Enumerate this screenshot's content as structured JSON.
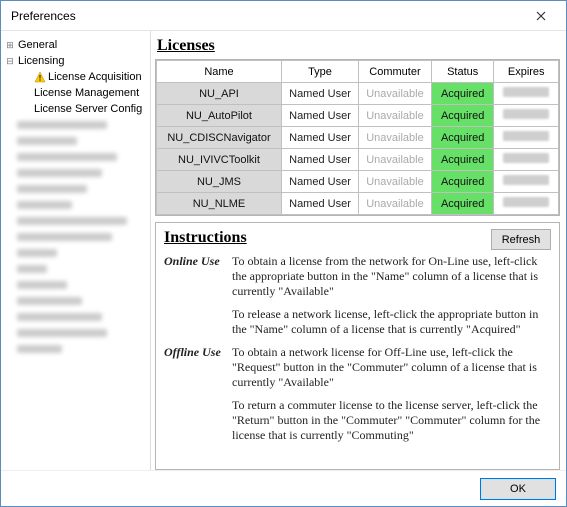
{
  "window": {
    "title": "Preferences"
  },
  "tree": {
    "items": [
      {
        "label": "General"
      },
      {
        "label": "Licensing"
      },
      {
        "label": "License Acquisition"
      },
      {
        "label": "License Management"
      },
      {
        "label": "License Server Config"
      }
    ],
    "redacted_count": 15
  },
  "licenses": {
    "heading": "Licenses",
    "columns": [
      "Name",
      "Type",
      "Commuter",
      "Status",
      "Expires"
    ],
    "rows": [
      {
        "name": "NU_API",
        "type": "Named User",
        "commuter": "Unavailable",
        "status": "Acquired"
      },
      {
        "name": "NU_AutoPilot",
        "type": "Named User",
        "commuter": "Unavailable",
        "status": "Acquired"
      },
      {
        "name": "NU_CDISCNavigator",
        "type": "Named User",
        "commuter": "Unavailable",
        "status": "Acquired"
      },
      {
        "name": "NU_IVIVCToolkit",
        "type": "Named User",
        "commuter": "Unavailable",
        "status": "Acquired"
      },
      {
        "name": "NU_JMS",
        "type": "Named User",
        "commuter": "Unavailable",
        "status": "Acquired"
      },
      {
        "name": "NU_NLME",
        "type": "Named User",
        "commuter": "Unavailable",
        "status": "Acquired"
      }
    ]
  },
  "instructions": {
    "heading": "Instructions",
    "refresh": "Refresh",
    "sections": [
      {
        "label": "Online Use",
        "paras": [
          "To obtain a license from the network for On-Line use, left-click the appropriate button in the \"Name\" column of a license that is currently \"Available\"",
          "To release a network license, left-click the appropriate button in the \"Name\" column of a license that is currently \"Acquired\""
        ]
      },
      {
        "label": "Offline Use",
        "paras": [
          "To obtain a network license for Off-Line use, left-click the \"Request\" button in the \"Commuter\" column of a license that is currently \"Available\"",
          "To return a commuter license to the license server, left-click the \"Return\" button in the \"Commuter\" \"Commuter\" column for the license that is currently \"Commuting\""
        ]
      }
    ]
  },
  "footer": {
    "ok": "OK"
  }
}
